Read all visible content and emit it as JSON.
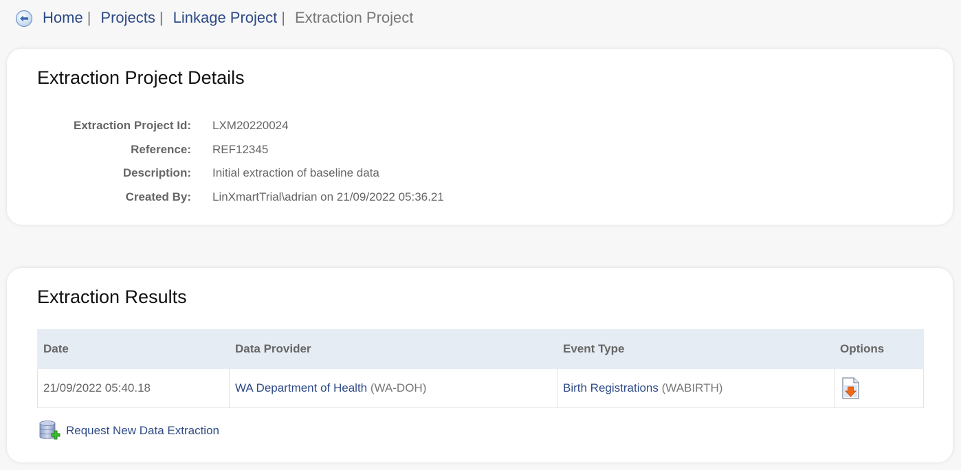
{
  "breadcrumb": {
    "back_icon": "back-arrow-circle-icon",
    "items": [
      {
        "label": "Home",
        "link": true
      },
      {
        "label": "Projects",
        "link": true
      },
      {
        "label": "Linkage Project",
        "link": true
      },
      {
        "label": "Extraction Project",
        "link": false
      }
    ],
    "separator": "|"
  },
  "details": {
    "title": "Extraction Project Details",
    "fields": [
      {
        "label": "Extraction Project Id:",
        "value": "LXM20220024"
      },
      {
        "label": "Reference:",
        "value": "REF12345"
      },
      {
        "label": "Description:",
        "value": "Initial extraction of baseline data"
      },
      {
        "label": "Created By:",
        "value": "LinXmartTrial\\adrian on 21/09/2022 05:36.21"
      }
    ]
  },
  "results": {
    "title": "Extraction Results",
    "columns": [
      "Date",
      "Data Provider",
      "Event Type",
      "Options"
    ],
    "rows": [
      {
        "date": "21/09/2022 05:40.18",
        "provider_name": "WA Department of Health",
        "provider_code": "(WA-DOH)",
        "event_name": "Birth Registrations",
        "event_code": "(WABIRTH)",
        "option_icon": "download-document-icon"
      }
    ],
    "request_label": "Request New Data Extraction",
    "request_icon": "database-add-icon"
  },
  "colors": {
    "link": "#2d4a86",
    "muted_text": "#666666",
    "table_header_bg": "#e6ecf3",
    "page_bg": "#f7f7f7"
  }
}
